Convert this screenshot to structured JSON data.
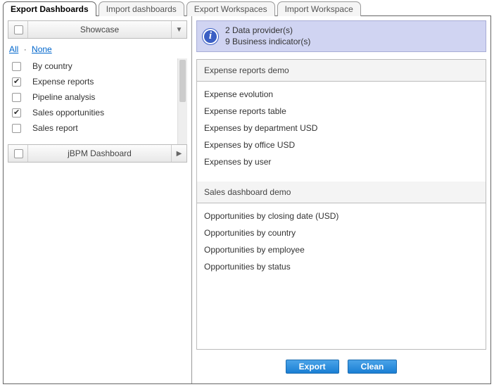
{
  "tabs": [
    {
      "label": "Export Dashboards",
      "active": true
    },
    {
      "label": "Import dashboards",
      "active": false
    },
    {
      "label": "Export Workspaces",
      "active": false
    },
    {
      "label": "Import Workspace",
      "active": false
    }
  ],
  "sections": {
    "showcase": {
      "title": "Showcase",
      "links": {
        "all": "All",
        "none": "None"
      },
      "items": [
        {
          "label": "By country",
          "checked": false
        },
        {
          "label": "Expense reports",
          "checked": true
        },
        {
          "label": "Pipeline analysis",
          "checked": false
        },
        {
          "label": "Sales opportunities",
          "checked": true
        },
        {
          "label": "Sales report",
          "checked": false
        }
      ]
    },
    "jbpm": {
      "title": "jBPM Dashboard"
    }
  },
  "info": {
    "line1": "2 Data provider(s)",
    "line2": "9 Business indicator(s)"
  },
  "groups": [
    {
      "header": "Expense reports demo",
      "rows": [
        "Expense evolution",
        "Expense reports table",
        "Expenses by department USD",
        "Expenses by office USD",
        "Expenses by user"
      ]
    },
    {
      "header": "Sales dashboard demo",
      "rows": [
        "Opportunities by closing date (USD)",
        "Opportunities by country",
        "Opportunities by employee",
        "Opportunities by status"
      ]
    }
  ],
  "buttons": {
    "export": "Export",
    "clean": "Clean"
  }
}
